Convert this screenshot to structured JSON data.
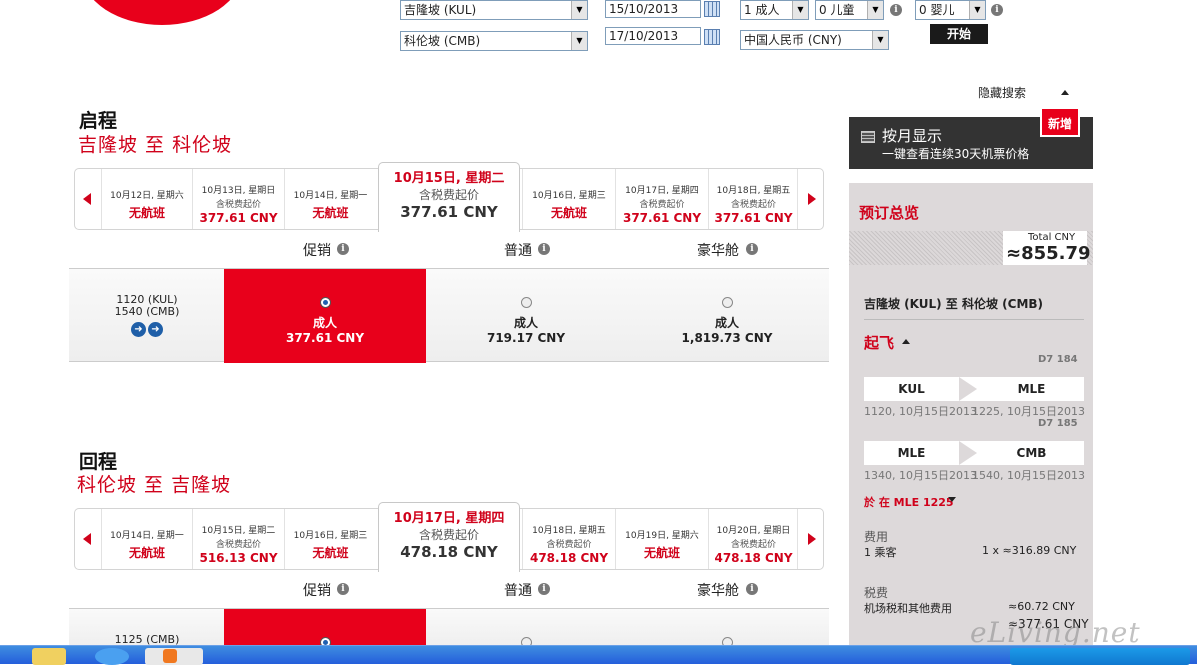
{
  "search": {
    "origin": "吉隆坡 (KUL)",
    "destination": "科伦坡 (CMB)",
    "depart_date": "15/10/2013",
    "return_date": "17/10/2013",
    "adults": "1 成人",
    "children": "0 儿童",
    "infants": "0 婴儿",
    "currency": "中国人民币 (CNY)",
    "go_button": "开始",
    "hide_search": "隐藏搜索"
  },
  "outbound": {
    "heading": "启程",
    "route": "吉隆坡 至 科伦坡",
    "dates": [
      {
        "label": "10月12日, 星期六",
        "caption": "",
        "status": "无航班",
        "price": ""
      },
      {
        "label": "10月13日, 星期日",
        "caption": "含税费起价",
        "status": "",
        "price": "377.61 CNY"
      },
      {
        "label": "10月14日, 星期一",
        "caption": "",
        "status": "无航班",
        "price": ""
      },
      {
        "label": "10月16日, 星期三",
        "caption": "",
        "status": "无航班",
        "price": ""
      },
      {
        "label": "10月17日, 星期四",
        "caption": "含税费起价",
        "status": "",
        "price": "377.61 CNY"
      },
      {
        "label": "10月18日, 星期五",
        "caption": "含税费起价",
        "status": "",
        "price": "377.61 CNY"
      }
    ],
    "selected": {
      "label": "10月15日, 星期二",
      "caption": "含税费起价",
      "price": "377.61 CNY"
    },
    "fare_classes": [
      "促销",
      "普通",
      "豪华舱"
    ],
    "flight": {
      "dep": "1120 (KUL)",
      "arr": "1540 (CMB)",
      "fares": [
        {
          "pax": "成人",
          "price": "377.61 CNY",
          "selected": true
        },
        {
          "pax": "成人",
          "price": "719.17 CNY",
          "selected": false
        },
        {
          "pax": "成人",
          "price": "1,819.73 CNY",
          "selected": false
        }
      ]
    }
  },
  "inbound": {
    "heading": "回程",
    "route": "科伦坡 至 吉隆坡",
    "dates": [
      {
        "label": "10月14日, 星期一",
        "caption": "",
        "status": "无航班",
        "price": ""
      },
      {
        "label": "10月15日, 星期二",
        "caption": "含税费起价",
        "status": "",
        "price": "516.13 CNY"
      },
      {
        "label": "10月16日, 星期三",
        "caption": "",
        "status": "无航班",
        "price": ""
      },
      {
        "label": "10月18日, 星期五",
        "caption": "含税费起价",
        "status": "",
        "price": "478.18 CNY"
      },
      {
        "label": "10月19日, 星期六",
        "caption": "",
        "status": "无航班",
        "price": ""
      },
      {
        "label": "10月20日, 星期日",
        "caption": "含税费起价",
        "status": "",
        "price": "478.18 CNY"
      }
    ],
    "selected": {
      "label": "10月17日, 星期四",
      "caption": "含税费起价",
      "price": "478.18 CNY"
    },
    "fare_classes": [
      "促销",
      "普通",
      "豪华舱"
    ],
    "flight": {
      "dep": "1125 (CMB)"
    }
  },
  "sidebar": {
    "month_view": "按月显示",
    "month_view_sub": "一键查看连续30天机票价格",
    "new_badge": "新增",
    "summary_title": "预订总览",
    "total_label": "Total CNY",
    "total_value": "≈855.79",
    "route": "吉隆坡 (KUL) 至 科伦坡 (CMB)",
    "depart_label": "起飞",
    "leg1": {
      "flight": "D7 184",
      "from": "KUL",
      "to": "MLE",
      "from_time": "1120, 10月15日2013",
      "to_time": "1225, 10月15日2013"
    },
    "leg2": {
      "flight": "D7 185",
      "from": "MLE",
      "to": "CMB",
      "from_time": "1340, 10月15日2013",
      "to_time": "1540, 10月15日2013"
    },
    "stopover": "於 在 MLE 1225",
    "fee_label": "费用",
    "pax_count": "1 乘客",
    "pax_fee": "1 x ≈316.89 CNY",
    "tax_label": "税费",
    "tax_item": "机场税和其他费用",
    "tax_value": "≈60.72 CNY",
    "subtotal": "≈377.61 CNY"
  },
  "watermark": "eLiving.net"
}
